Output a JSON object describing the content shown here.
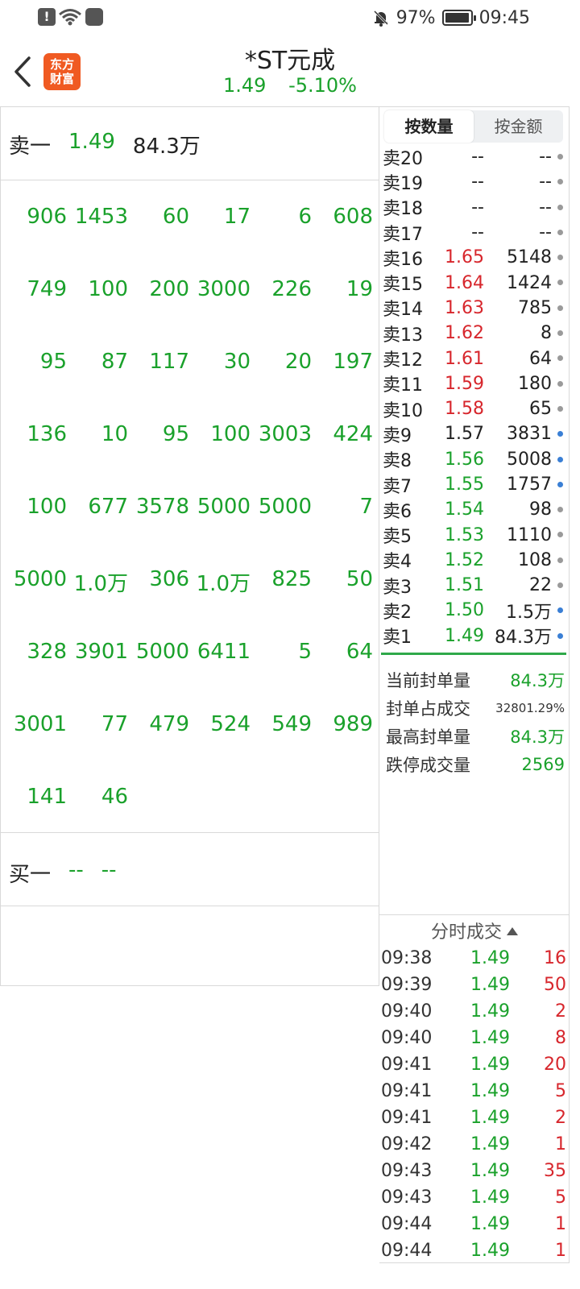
{
  "status_bar": {
    "battery": "97%",
    "time": "09:45",
    "battery_level": 0.97,
    "icons": [
      "alert-icon",
      "wifi-icon",
      "bag-icon",
      "bell-muted-icon",
      "battery-icon"
    ]
  },
  "header": {
    "logo_line1": "东方",
    "logo_line2": "财富",
    "stock_name": "*ST元成",
    "price": "1.49",
    "change_pct": "-5.10%"
  },
  "left_panel": {
    "sell1": {
      "label": "卖一",
      "price": "1.49",
      "volume": "84.3万"
    },
    "orders": [
      [
        "906",
        "1453",
        "60",
        "17",
        "6",
        "608"
      ],
      [
        "749",
        "100",
        "200",
        "3000",
        "226",
        "19"
      ],
      [
        "95",
        "87",
        "117",
        "30",
        "20",
        "197"
      ],
      [
        "136",
        "10",
        "95",
        "100",
        "3003",
        "424"
      ],
      [
        "100",
        "677",
        "3578",
        "5000",
        "5000",
        "7"
      ],
      [
        "5000",
        "1.0万",
        "306",
        "1.0万",
        "825",
        "50"
      ],
      [
        "328",
        "3901",
        "5000",
        "6411",
        "5",
        "64"
      ],
      [
        "3001",
        "77",
        "479",
        "524",
        "549",
        "989"
      ],
      [
        "141",
        "46"
      ]
    ],
    "buy1": {
      "label": "买一",
      "price": "--",
      "volume": "--"
    }
  },
  "right_panel": {
    "tabs": [
      "按数量",
      "按金额"
    ],
    "active_tab": 0,
    "book": [
      {
        "label": "卖20",
        "price": "--",
        "vol": "--",
        "color": "black",
        "dot": "#9a9a9a"
      },
      {
        "label": "卖19",
        "price": "--",
        "vol": "--",
        "color": "black",
        "dot": "#9a9a9a"
      },
      {
        "label": "卖18",
        "price": "--",
        "vol": "--",
        "color": "black",
        "dot": "#9a9a9a"
      },
      {
        "label": "卖17",
        "price": "--",
        "vol": "--",
        "color": "black",
        "dot": "#9a9a9a"
      },
      {
        "label": "卖16",
        "price": "1.65",
        "vol": "5148",
        "color": "red",
        "dot": "#9a9a9a"
      },
      {
        "label": "卖15",
        "price": "1.64",
        "vol": "1424",
        "color": "red",
        "dot": "#9a9a9a"
      },
      {
        "label": "卖14",
        "price": "1.63",
        "vol": "785",
        "color": "red",
        "dot": "#9a9a9a"
      },
      {
        "label": "卖13",
        "price": "1.62",
        "vol": "8",
        "color": "red",
        "dot": "#9a9a9a"
      },
      {
        "label": "卖12",
        "price": "1.61",
        "vol": "64",
        "color": "red",
        "dot": "#9a9a9a"
      },
      {
        "label": "卖11",
        "price": "1.59",
        "vol": "180",
        "color": "red",
        "dot": "#9a9a9a"
      },
      {
        "label": "卖10",
        "price": "1.58",
        "vol": "65",
        "color": "red",
        "dot": "#9a9a9a"
      },
      {
        "label": "卖9",
        "price": "1.57",
        "vol": "3831",
        "color": "black",
        "dot": "#3a7fd5"
      },
      {
        "label": "卖8",
        "price": "1.56",
        "vol": "5008",
        "color": "green",
        "dot": "#3a7fd5"
      },
      {
        "label": "卖7",
        "price": "1.55",
        "vol": "1757",
        "color": "green",
        "dot": "#3a7fd5"
      },
      {
        "label": "卖6",
        "price": "1.54",
        "vol": "98",
        "color": "green",
        "dot": "#9a9a9a"
      },
      {
        "label": "卖5",
        "price": "1.53",
        "vol": "1110",
        "color": "green",
        "dot": "#9a9a9a"
      },
      {
        "label": "卖4",
        "price": "1.52",
        "vol": "108",
        "color": "green",
        "dot": "#9a9a9a"
      },
      {
        "label": "卖3",
        "price": "1.51",
        "vol": "22",
        "color": "green",
        "dot": "#9a9a9a"
      },
      {
        "label": "卖2",
        "price": "1.50",
        "vol": "1.5万",
        "color": "green",
        "dot": "#3a7fd5"
      },
      {
        "label": "卖1",
        "price": "1.49",
        "vol": "84.3万",
        "color": "green",
        "dot": "#3a7fd5"
      }
    ],
    "stats": [
      {
        "label": "当前封单量",
        "value": "84.3万",
        "style": "green"
      },
      {
        "label": "封单占成交",
        "value": "32801.29%",
        "style": "small"
      },
      {
        "label": "最高封单量",
        "value": "84.3万",
        "style": "green"
      },
      {
        "label": "跌停成交量",
        "value": "2569",
        "style": "green"
      }
    ],
    "ticks_title": "分时成交",
    "ticks": [
      {
        "time": "09:38",
        "price": "1.49",
        "vol": "16"
      },
      {
        "time": "09:39",
        "price": "1.49",
        "vol": "50"
      },
      {
        "time": "09:40",
        "price": "1.49",
        "vol": "2"
      },
      {
        "time": "09:40",
        "price": "1.49",
        "vol": "8"
      },
      {
        "time": "09:41",
        "price": "1.49",
        "vol": "20"
      },
      {
        "time": "09:41",
        "price": "1.49",
        "vol": "5"
      },
      {
        "time": "09:41",
        "price": "1.49",
        "vol": "2"
      },
      {
        "time": "09:42",
        "price": "1.49",
        "vol": "1"
      },
      {
        "time": "09:43",
        "price": "1.49",
        "vol": "35"
      },
      {
        "time": "09:43",
        "price": "1.49",
        "vol": "5"
      },
      {
        "time": "09:44",
        "price": "1.49",
        "vol": "1"
      },
      {
        "time": "09:44",
        "price": "1.49",
        "vol": "1"
      }
    ]
  }
}
